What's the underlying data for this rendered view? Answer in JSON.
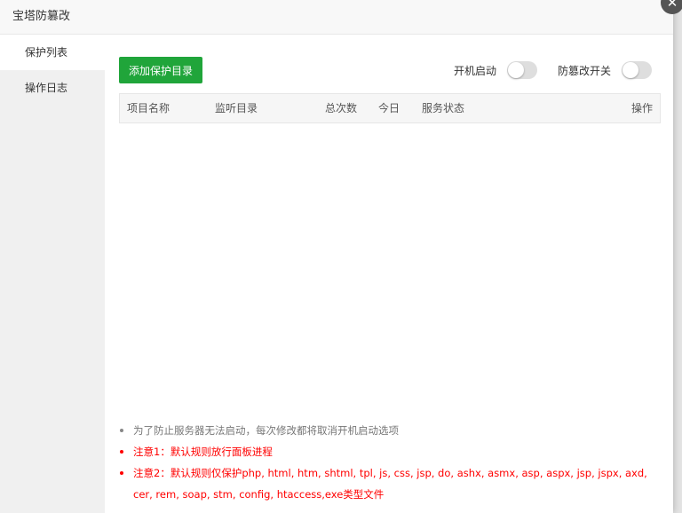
{
  "modal": {
    "title": "宝塔防篡改",
    "close_icon": "close-icon"
  },
  "sidebar": {
    "items": [
      {
        "label": "保护列表",
        "active": true
      },
      {
        "label": "操作日志",
        "active": false
      }
    ]
  },
  "toolbar": {
    "add_button_label": "添加保护目录",
    "startup_toggle_label": "开机启动",
    "startup_toggle_on": false,
    "tamper_toggle_label": "防篡改开关",
    "tamper_toggle_on": false
  },
  "table": {
    "columns": [
      "项目名称",
      "监听目录",
      "总次数",
      "今日",
      "服务状态",
      "操作"
    ],
    "rows": []
  },
  "notes": [
    {
      "text": "为了防止服务器无法启动，每次修改都将取消开机启动选项",
      "color": "#777777"
    },
    {
      "text": "注意1：默认规则放行面板进程",
      "color": "#ff0000"
    },
    {
      "text": "注意2：默认规则仅保护php, html, htm, shtml, tpl, js, css, jsp, do, ashx, asmx, asp, aspx, jsp, jspx, axd, cer, rem, soap, stm, config, htaccess,exe类型文件",
      "color": "#ff0000"
    }
  ],
  "colors": {
    "accent": "#20a53a",
    "warning": "#ff0000"
  }
}
